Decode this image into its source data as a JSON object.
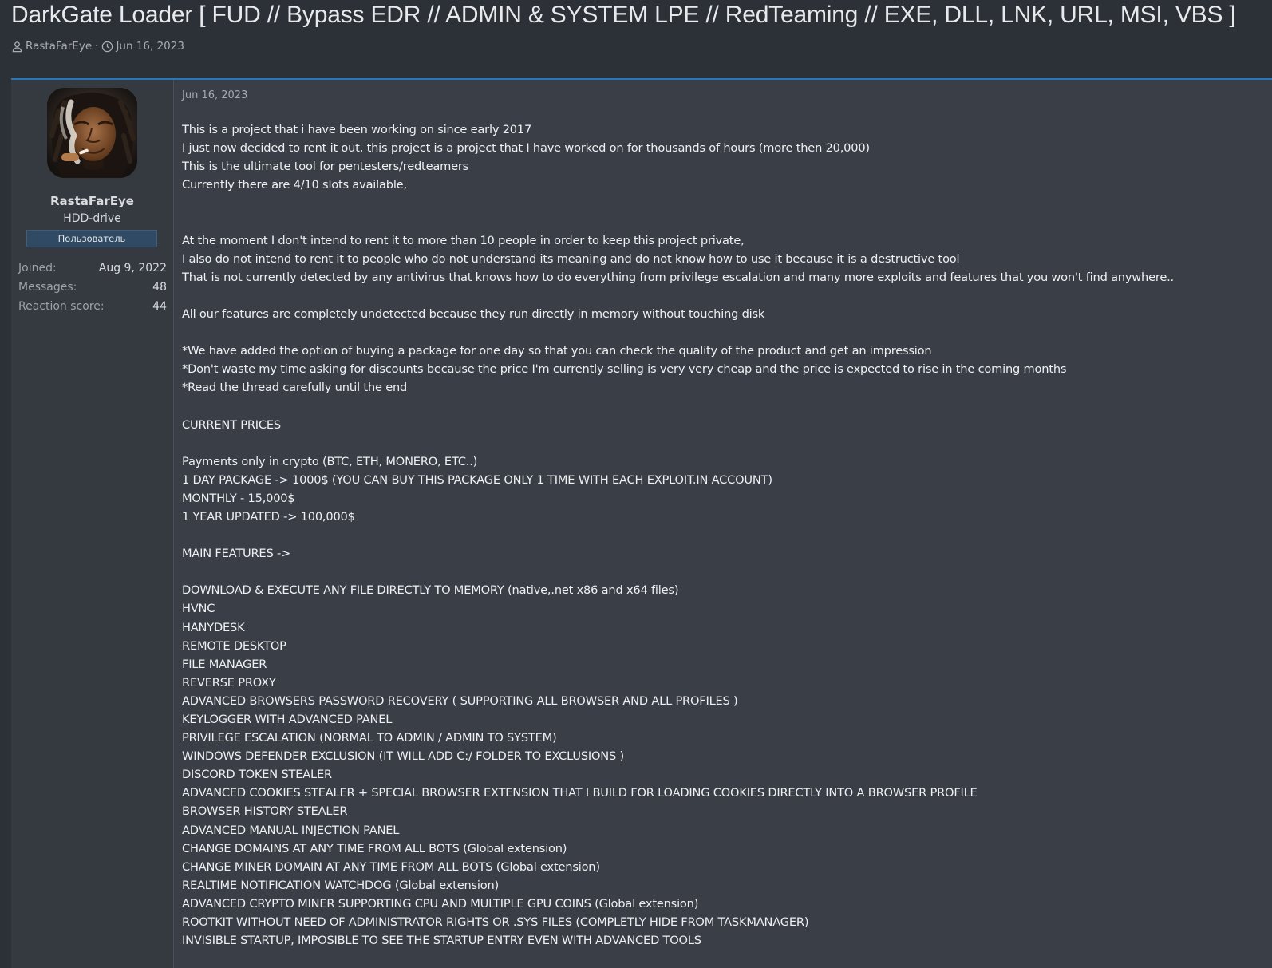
{
  "thread": {
    "title": "DarkGate Loader [ FUD // Bypass EDR // ADMIN & SYSTEM LPE // RedTeaming // EXE, DLL, LNK, URL, MSI, VBS ]",
    "author": "RastaFarEye",
    "separator": "·",
    "date": "Jun 16, 2023"
  },
  "user": {
    "name": "RastaFarEye",
    "title": "HDD-drive",
    "banner": "Пользователь",
    "stats": [
      {
        "label": "Joined:",
        "value": "Aug 9, 2022"
      },
      {
        "label": "Messages:",
        "value": "48"
      },
      {
        "label": "Reaction score:",
        "value": "44"
      }
    ]
  },
  "post": {
    "date": "Jun 16, 2023",
    "lines": [
      "This is a project that i have been working on since early 2017",
      "I just now decided to rent it out, this project is a project that I have worked on for thousands of hours (more then 20,000)",
      "This is the ultimate tool for pentesters/redteamers",
      "Currently there are 4/10 slots available,",
      "",
      "",
      "At the moment I don't intend to rent it to more than 10 people in order to keep this project private,",
      "I also do not intend to rent it to people who do not understand its meaning and do not know how to use it because it is a destructive tool",
      "That is not currently detected by any antivirus that knows how to do everything from privilege escalation and many more exploits and features that you won't find anywhere..",
      "",
      "All our features are completely undetected because they run directly in memory without touching disk",
      "",
      "*We have added the option of buying a package for one day so that you can check the quality of the product and get an impression",
      "*Don't waste my time asking for discounts because the price I'm currently selling is very very cheap and the price is expected to rise in the coming months",
      "*Read the thread carefully until the end",
      "",
      "CURRENT PRICES",
      "",
      "Payments only in crypto (BTC, ETH, MONERO, ETC..)",
      "1 DAY PACKAGE -> 1000$ (YOU CAN BUY THIS PACKAGE ONLY 1 TIME WITH EACH EXPLOIT.IN ACCOUNT)",
      "MONTHLY - 15,000$",
      "1 YEAR UPDATED -> 100,000$",
      "",
      "MAIN FEATURES ->",
      "",
      "DOWNLOAD & EXECUTE ANY FILE DIRECTLY TO MEMORY (native,.net x86 and x64 files)",
      "HVNC",
      "HANYDESK",
      "REMOTE DESKTOP",
      "FILE MANAGER",
      "REVERSE PROXY",
      "ADVANCED BROWSERS PASSWORD RECOVERY ( SUPPORTING ALL BROWSER AND ALL PROFILES )",
      "KEYLOGGER WITH ADVANCED PANEL",
      "PRIVILEGE ESCALATION (NORMAL TO ADMIN / ADMIN TO SYSTEM)",
      "WINDOWS DEFENDER EXCLUSION (IT WILL ADD C:/ FOLDER TO EXCLUSIONS )",
      "DISCORD TOKEN STEALER",
      "ADVANCED COOKIES STEALER + SPECIAL BROWSER EXTENSION THAT I BUILD FOR LOADING COOKIES DIRECTLY INTO A BROWSER PROFILE",
      "BROWSER HISTORY STEALER",
      "ADVANCED MANUAL INJECTION PANEL",
      "CHANGE DOMAINS AT ANY TIME FROM ALL BOTS (Global extension)",
      "CHANGE MINER DOMAIN AT ANY TIME FROM ALL BOTS (Global extension)",
      "REALTIME NOTIFICATION WATCHDOG (Global extension)",
      "ADVANCED CRYPTO MINER SUPPORTING CPU AND MULTIPLE GPU COINS (Global extension)",
      "ROOTKIT WITHOUT NEED OF ADMINISTRATOR RIGHTS OR .SYS FILES (COMPLETLY HIDE FROM TASKMANAGER)",
      "INVISIBLE STARTUP, IMPOSIBLE TO SEE THE STARTUP ENTRY EVEN WITH ADVANCED TOOLS"
    ]
  },
  "colors": {
    "accent": "#2a77b8",
    "page_bg": "#2c3138",
    "post_bg": "#3a3f47",
    "user_bg": "#353a41"
  },
  "icons": {
    "author": "user-icon",
    "date": "clock-icon"
  }
}
